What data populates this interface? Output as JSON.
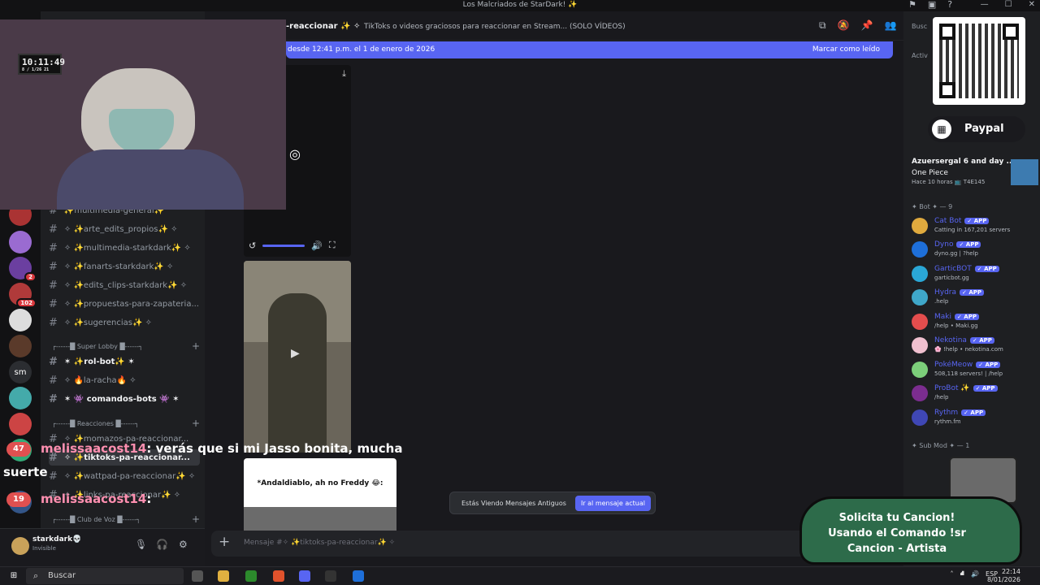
{
  "window": {
    "title": "Los Malcriados de StarDark! ✨"
  },
  "channel": {
    "name": "-reaccionar ✨ ✧",
    "topic": "TikToks o videos graciosos para reaccionar en Stream... (SOLO VÍDEOS)"
  },
  "new_messages": {
    "text": "desde 12:41 p.m. el 1 de enero de 2026",
    "mark_read": "Marcar como leído"
  },
  "channels": {
    "items": [
      {
        "label": "✨multimedia-general✨"
      },
      {
        "label": "✧ ✨arte_edits_propios✨ ✧"
      },
      {
        "label": "✧ ✨multimedia-starkdark✨ ✧"
      },
      {
        "label": "✧ ✨fanarts-starkdark✨ ✧"
      },
      {
        "label": "✧ ✨edits_clips-starkdark✨ ✧"
      },
      {
        "label": "✧ ✨propuestas-para-zapateria..."
      },
      {
        "label": "✧ ✨sugerencias✨ ✧"
      },
      {
        "label": "✶ ✨rol-bot✨ ✶"
      },
      {
        "label": "✧ 🔥la-racha🔥 ✧"
      },
      {
        "label": "✶ 👾 comandos-bots 👾 ✶"
      },
      {
        "label": "✧ ✨momazos-pa-reaccionar..."
      },
      {
        "label": "✧ ✨tiktoks-pa-reaccionar..."
      },
      {
        "label": "✧ ✨wattpad-pa-reaccionar✨ ✧"
      },
      {
        "label": "✧ ✨links-pa-reaccionar✨ ✧"
      }
    ],
    "categories": [
      {
        "label": "┌------█ Super Lobby █------┐"
      },
      {
        "label": "┌------█ Reacciones █------┐"
      },
      {
        "label": "┌------█ Club de Voz █------┐"
      }
    ]
  },
  "guild_badges": {
    "b1": "2",
    "b2": "102",
    "sm": "sm"
  },
  "user": {
    "name": "starkdark💀",
    "status": "Invisible"
  },
  "old_messages": {
    "text": "Estás Viendo Mensajes Antiguos",
    "button": "Ir al mensaje actual"
  },
  "card3": {
    "text": "*Andaldiablo, ah no Freddy 😂:"
  },
  "composer": {
    "placeholder": "Mensaje #✧ ✨tiktoks-pa-reaccionar✨ ✧"
  },
  "members": {
    "search": "Busc",
    "active": "Activ",
    "activity": {
      "name": "Azuersergal 6 and day ...",
      "title": "One Piece",
      "sub": "Hace 10 horas  📺 T4E145"
    },
    "bot_header": "✦ Bot ✦ — 9",
    "bots": [
      {
        "name": "Cat Bot",
        "tag": "✓ APP",
        "sub": "Catting in 167,201 servers",
        "color": "#e0aa3e"
      },
      {
        "name": "Dyno",
        "tag": "✓ APP",
        "sub": "dyno.gg | ?help",
        "color": "#1e6fd9"
      },
      {
        "name": "GarticBOT",
        "tag": "✓ APP",
        "sub": "garticbot.gg",
        "color": "#2aa7d6"
      },
      {
        "name": "Hydra",
        "tag": "✓ APP",
        "sub": ".help",
        "color": "#3fa7c9"
      },
      {
        "name": "Maki",
        "tag": "✓ APP",
        "sub": "/help • Maki.gg",
        "color": "#e44d4d"
      },
      {
        "name": "Nekotina",
        "tag": "✓ APP",
        "sub": "🌸 !help • nekotina.com",
        "color": "#f0c0cf"
      },
      {
        "name": "PokéMeow",
        "tag": "✓ APP",
        "sub": "508,118 servers! | /help",
        "color": "#7ccf7a"
      },
      {
        "name": "ProBot ✨",
        "tag": "✓ APP",
        "sub": "/help",
        "color": "#7b2d8f"
      },
      {
        "name": "Rythm",
        "tag": "✓ APP",
        "sub": "rythm.fm",
        "color": "#3f47b5"
      }
    ],
    "submod_header": "✦ Sub Mod ✦ — 1"
  },
  "overlay": {
    "paypal": "Paypal",
    "chat": [
      {
        "name": "melissaacost14",
        "text": ": verás que si mi Jasso bonita, mucha"
      },
      {
        "name": "",
        "text": "suerte"
      },
      {
        "name": "melissaacost14",
        "text": ":"
      }
    ],
    "badges": [
      "47",
      "19"
    ],
    "song": "Solicita tu Cancion! Usando el Comando !sr Cancion - Artista",
    "clock": "10:11:49",
    "clock_sub": "8 / 1/26   21"
  },
  "taskbar": {
    "search": "Buscar",
    "lang": "ESP",
    "time": "22:14",
    "date": "8/01/2026"
  },
  "colors": {
    "accent": "#5865f2",
    "bot_name": "#5865f2"
  }
}
